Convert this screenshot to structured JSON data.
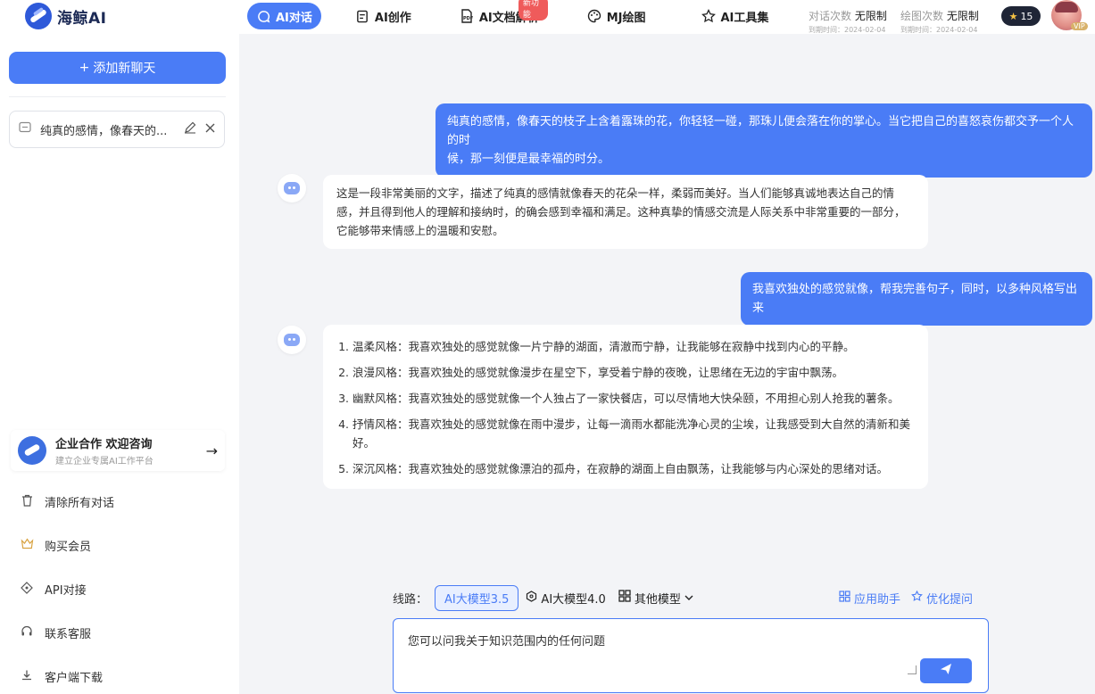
{
  "header": {
    "logo_text": "海鲸AI",
    "nav": [
      {
        "label": "AI对话",
        "icon": "chat-icon"
      },
      {
        "label": "AI创作",
        "icon": "document-edit-icon"
      },
      {
        "label": "AI文档解析",
        "icon": "pdf-icon",
        "badge": "新功能"
      },
      {
        "label": "MJ绘图",
        "icon": "palette-icon"
      },
      {
        "label": "AI工具集",
        "icon": "star-outline-icon"
      }
    ],
    "quota_chat_label": "对话次数",
    "quota_chat_value": "无限制",
    "quota_chat_expire": "到期时间：2024-02-04",
    "quota_draw_label": "绘图次数",
    "quota_draw_value": "无限制",
    "quota_draw_expire": "到期时间：2024-02-04",
    "stars": "15",
    "vip_label": "VIP"
  },
  "sidebar": {
    "new_chat_label": "添加新聊天",
    "conversation_title": "纯真的感情，像春天的...",
    "promo_title": "企业合作 欢迎咨询",
    "promo_subtitle": "建立企业专属AI工作平台",
    "menu": [
      {
        "label": "清除所有对话",
        "icon": "trash-icon"
      },
      {
        "label": "购买会员",
        "icon": "crown-icon"
      },
      {
        "label": "API对接",
        "icon": "api-icon"
      },
      {
        "label": "联系客服",
        "icon": "headset-icon"
      },
      {
        "label": "客户端下载",
        "icon": "download-icon"
      }
    ]
  },
  "chat": {
    "user_msg_1_line1": "纯真的感情，像春天的枝子上含着露珠的花，你轻轻一碰，那珠儿便会落在你的掌心。当它把自己的喜怒哀伤都交予一个人的时",
    "user_msg_1_line2": "候，那一刻便是最幸福的时分。",
    "bot_msg_1_line1": "这是一段非常美丽的文字，描述了纯真的感情就像春天的花朵一样，柔弱而美好。当人们能够真诚地表达自己的情",
    "bot_msg_1_line2": "感，并且得到他人的理解和接纳时，的确会感到幸福和满足。这种真挚的情感交流是人际关系中非常重要的一部分，",
    "bot_msg_1_line3": "它能够带来情感上的温暖和安慰。",
    "user_msg_2": "我喜欢独处的感觉就像，帮我完善句子，同时，以多种风格写出来",
    "bot_msg_2_items": [
      "温柔风格：我喜欢独处的感觉就像一片宁静的湖面，清澈而宁静，让我能够在寂静中找到内心的平静。",
      "浪漫风格：我喜欢独处的感觉就像漫步在星空下，享受着宁静的夜晚，让思绪在无边的宇宙中飘荡。",
      "幽默风格：我喜欢独处的感觉就像一个人独占了一家快餐店，可以尽情地大快朵颐，不用担心别人抢我的薯条。",
      "抒情风格：我喜欢独处的感觉就像在雨中漫步，让每一滴雨水都能洗净心灵的尘埃，让我感受到大自然的清新和美好。",
      "深沉风格：我喜欢独处的感觉就像漂泊的孤舟，在寂静的湖面上自由飘荡，让我能够与内心深处的思绪对话。"
    ]
  },
  "composer": {
    "route_label": "线路：",
    "model_selected": "AI大模型3.5",
    "model_alt": "AI大模型4.0",
    "model_more": "其他模型",
    "app_helper": "应用助手",
    "optimize_prompt": "优化提问",
    "input_placeholder": "您可以问我关于知识范围内的任何问题"
  },
  "colors": {
    "accent": "#4a7cf6",
    "background": "#f3f4f7"
  }
}
